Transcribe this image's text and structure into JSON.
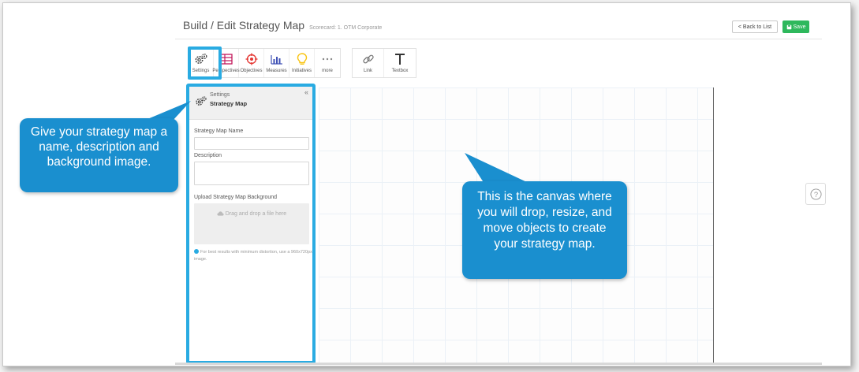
{
  "header": {
    "title": "Build / Edit Strategy Map",
    "scorecard": "Scorecard: 1. OTM Corporate",
    "back_label": "< Back to List",
    "save_label": "Save"
  },
  "toolbar": {
    "group1": [
      {
        "label": "Settings",
        "icon": "gears-icon"
      },
      {
        "label": "Perspectives",
        "icon": "table-icon"
      },
      {
        "label": "Objectives",
        "icon": "target-icon"
      },
      {
        "label": "Measures",
        "icon": "bar-chart-icon"
      },
      {
        "label": "Initiatives",
        "icon": "lightbulb-icon"
      },
      {
        "label": "more",
        "icon": "more-dots-icon"
      }
    ],
    "group2": [
      {
        "label": "Link",
        "icon": "link-icon"
      },
      {
        "label": "Textbox",
        "icon": "text-icon"
      }
    ]
  },
  "panel": {
    "header_small": "Settings",
    "header_title": "Strategy Map",
    "collapse": "«",
    "name_label": "Strategy Map Name",
    "name_value": "",
    "description_label": "Description",
    "description_value": "",
    "upload_label": "Upload Strategy Map Background",
    "dropzone_text": "Drag and drop a file here",
    "hint": "For best results with minimum distortion, use a 960x720px image."
  },
  "callouts": {
    "left": "Give your strategy map a name, description and background image.",
    "right": "This is the canvas where you will drop, resize, and move objects to create your strategy map."
  },
  "help": {
    "icon": "question-circle-icon",
    "glyph": "?"
  },
  "colors": {
    "highlight": "#29abe2",
    "callout": "#1a8fcf",
    "save": "#2eb85c",
    "perspectives": "#c2185b",
    "objectives": "#e53935",
    "measures": "#3f51b5",
    "initiatives": "#f9c412"
  }
}
